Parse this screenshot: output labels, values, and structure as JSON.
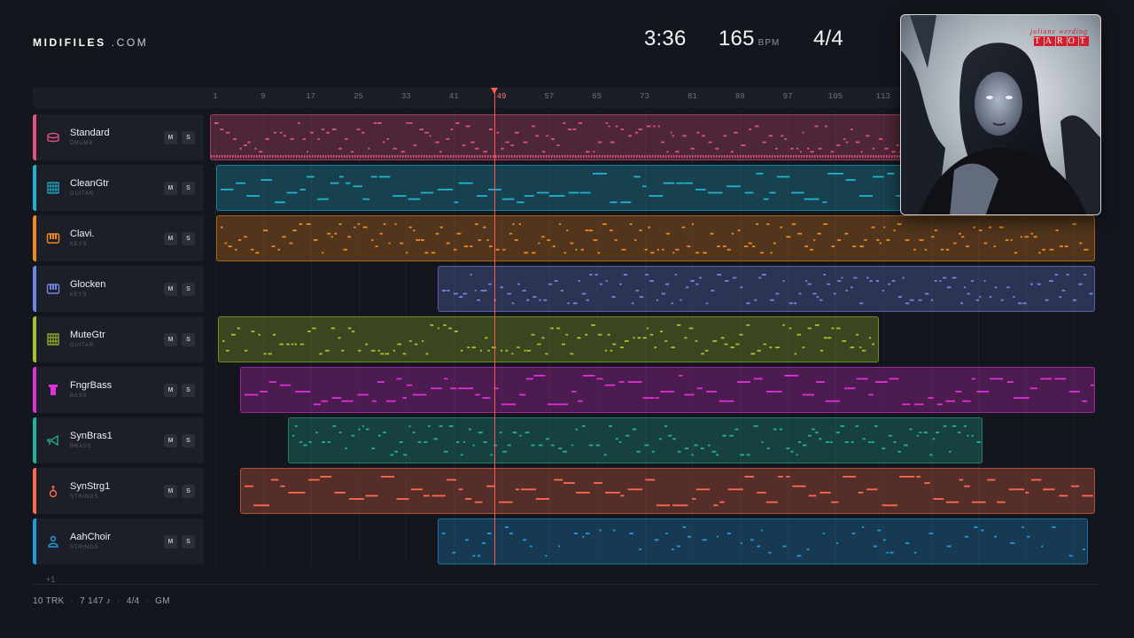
{
  "brand": {
    "name": "MIDIFILES",
    "domain": ".COM"
  },
  "stats": {
    "time": "3:36",
    "tempo": "165",
    "tempo_unit": "BPM",
    "signature": "4/4"
  },
  "ruler": {
    "ticks": [
      "1",
      "9",
      "17",
      "25",
      "33",
      "41",
      "49",
      "57",
      "65",
      "73",
      "81",
      "89",
      "97",
      "105",
      "113"
    ],
    "playhead_bar": "49"
  },
  "tracks": [
    {
      "name": "Standard",
      "category": "DRUMS",
      "color": "#e2517f",
      "icon": "drum-icon",
      "mute": "M",
      "solo": "S"
    },
    {
      "name": "CleanGtr",
      "category": "GUITAR",
      "color": "#1fb3cf",
      "icon": "guitar-icon",
      "mute": "M",
      "solo": "S"
    },
    {
      "name": "Clavi.",
      "category": "KEYS",
      "color": "#f08a1f",
      "icon": "keys-icon",
      "mute": "M",
      "solo": "S"
    },
    {
      "name": "Glocken",
      "category": "KEYS",
      "color": "#6f86e3",
      "icon": "keys-icon",
      "mute": "M",
      "solo": "S"
    },
    {
      "name": "MuteGtr",
      "category": "GUITAR",
      "color": "#a3c42a",
      "icon": "guitar-icon",
      "mute": "M",
      "solo": "S"
    },
    {
      "name": "FngrBass",
      "category": "BASS",
      "color": "#df2fd8",
      "icon": "bass-icon",
      "mute": "M",
      "solo": "S"
    },
    {
      "name": "SynBras1",
      "category": "BRASS",
      "color": "#20b39a",
      "icon": "horn-icon",
      "mute": "M",
      "solo": "S"
    },
    {
      "name": "SynStrg1",
      "category": "STRINGS",
      "color": "#ff6a4d",
      "icon": "violin-icon",
      "mute": "M",
      "solo": "S"
    },
    {
      "name": "AahChoir",
      "category": "STRINGS",
      "color": "#1f9be0",
      "icon": "choir-icon",
      "mute": "M",
      "solo": "S"
    }
  ],
  "more_tracks": "+1",
  "footer": {
    "tracks": "10 TRK",
    "notes": "7 147 ♪",
    "signature": "4/4",
    "standard": "GM"
  },
  "album": {
    "artist": "juliane werding",
    "title": "TAROT"
  }
}
